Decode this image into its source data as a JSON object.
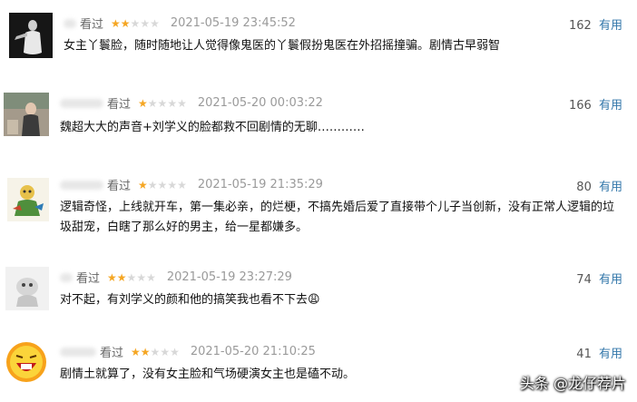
{
  "reviews": [
    {
      "status": "看过",
      "rating": 2,
      "max_rating": 5,
      "time": "2021-05-19 23:45:52",
      "votes": "162",
      "vote_label": "有用",
      "comment": "女主丫鬟脸，随时随地让人觉得像鬼医的丫鬟假扮鬼医在外招摇撞骗。剧情古早弱智"
    },
    {
      "status": "看过",
      "rating": 1,
      "max_rating": 5,
      "time": "2021-05-20 00:03:22",
      "votes": "166",
      "vote_label": "有用",
      "comment": "魏超大大的声音+刘学义的脸都救不回剧情的无聊…………"
    },
    {
      "status": "看过",
      "rating": 1,
      "max_rating": 5,
      "time": "2021-05-19 21:35:29",
      "votes": "80",
      "vote_label": "有用",
      "comment": "逻辑奇怪，上线就开车，第一集必亲，的烂梗，不搞先婚后爱了直接带个儿子当创新，没有正常人逻辑的垃圾甜宠，白瞎了那么好的男主，给一星都嫌多。"
    },
    {
      "status": "看过",
      "rating": 2,
      "max_rating": 5,
      "time": "2021-05-19 23:27:29",
      "votes": "74",
      "vote_label": "有用",
      "comment": "对不起，有刘学义的颜和他的搞笑我也看不下去😩"
    },
    {
      "status": "看过",
      "rating": 2,
      "max_rating": 5,
      "time": "2021-05-20 21:10:25",
      "votes": "41",
      "vote_label": "有用",
      "comment": "剧情土就算了，没有女主脸和气场硬演女主也是磕不动。"
    }
  ],
  "watermark": "头条 @龙仔荐片"
}
